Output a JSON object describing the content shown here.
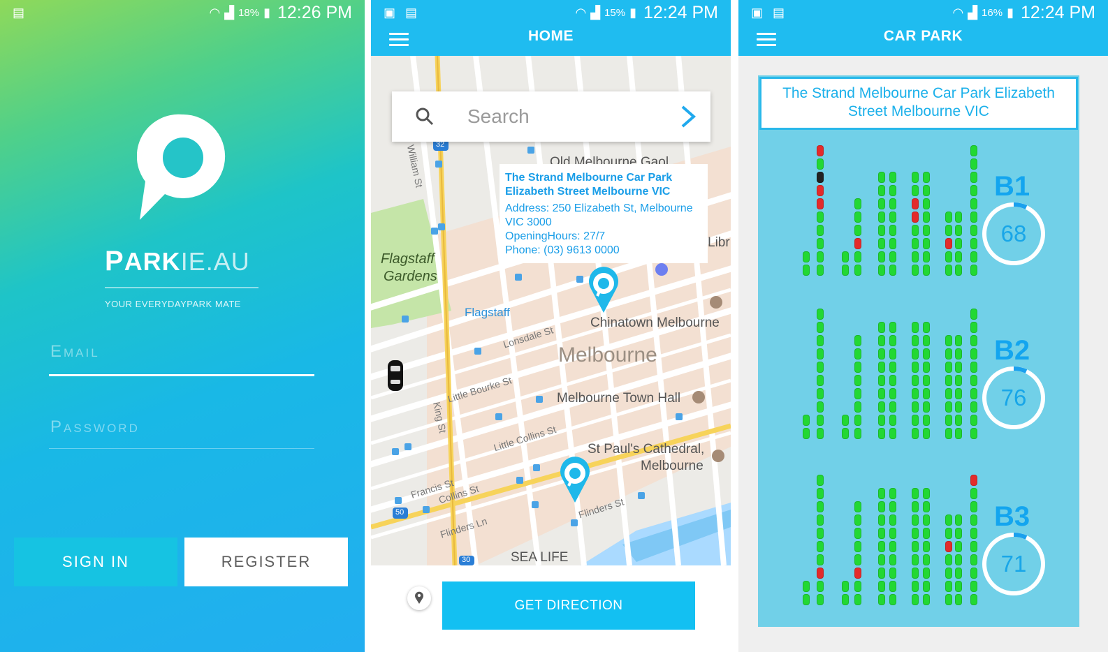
{
  "login": {
    "status": {
      "battery": "18%",
      "time": "12:26 PM"
    },
    "brand_p": "P",
    "brand_ark": "ARK",
    "brand_ie": "IE.AU",
    "tagline": "YOUR EVERYDAYPARK MATE",
    "email_label": "Email",
    "password_label": "Password",
    "signin_label": "SIGN IN",
    "register_label": "REGISTER"
  },
  "home": {
    "status": {
      "battery": "15%",
      "time": "12:24 PM"
    },
    "title": "HOME",
    "search_placeholder": "Search",
    "info": {
      "title_line1": "The Strand Melbourne Car Park",
      "title_line2": "Elizabeth Street Melbourne VIC",
      "address_line1": "Address: 250 Elizabeth St, Melbourne",
      "address_line2": "VIC 3000",
      "hours": "OpeningHours: 27/7",
      "phone": "Phone: (03) 9613 0000"
    },
    "map_labels": {
      "flagstaff_gardens_1": "Flagstaff",
      "flagstaff_gardens_2": "Gardens",
      "flagstaff": "Flagstaff",
      "chinatown": "Chinatown Melbourne",
      "melbourne": "Melbourne",
      "town_hall": "Melbourne Town Hall",
      "st_pauls_1": "St Paul's Cathedral,",
      "st_pauls_2": "Melbourne",
      "sea_life": "SEA LIFE",
      "old_gaol": "Old Melbourne Gaol",
      "libr": "Libr",
      "lonsdale": "Lonsdale St",
      "little_bourke": "Little Bourke St",
      "little_collins": "Little Collins St",
      "flinders": "Flinders St",
      "flinders_ln": "Flinders Ln",
      "collins": "Collins St",
      "francis": "Francis St",
      "king": "King St",
      "william": "William St",
      "route_32": "32",
      "route_50": "50",
      "route_30": "30"
    },
    "direction_label": "GET DIRECTION"
  },
  "carpark": {
    "status": {
      "battery": "16%",
      "time": "12:24 PM"
    },
    "title": "CAR PARK",
    "name_line1": "The Strand Melbourne Car Park Elizabeth",
    "name_line2": "Street Melbourne VIC",
    "levels": [
      {
        "name": "B1",
        "available": "68"
      },
      {
        "name": "B2",
        "available": "76"
      },
      {
        "name": "B3",
        "available": "71"
      }
    ]
  },
  "colors": {
    "accent": "#1fbcf0",
    "available": "#22d833",
    "occupied": "#e32b2b"
  }
}
